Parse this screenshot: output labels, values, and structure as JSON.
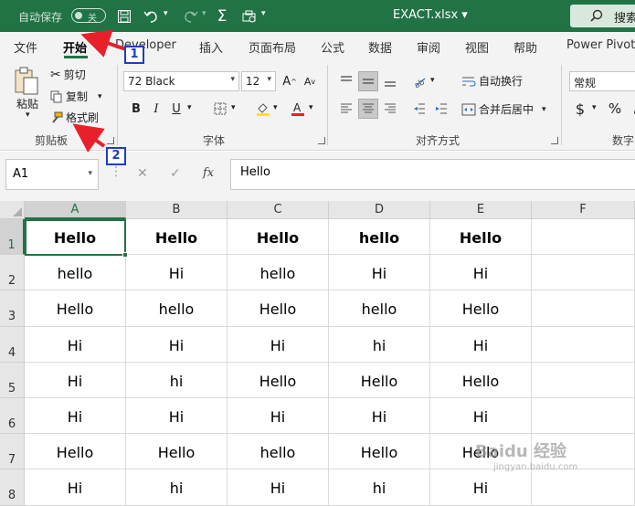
{
  "titlebar": {
    "autosave_label": "自动保存",
    "autosave_state": "关",
    "filename": "EXACT.xlsx",
    "search_label": "搜索"
  },
  "menu": {
    "tabs": [
      "文件",
      "开始",
      "Developer",
      "插入",
      "页面布局",
      "公式",
      "数据",
      "审阅",
      "视图",
      "帮助",
      "Power Pivot"
    ],
    "active": "开始"
  },
  "ribbon": {
    "clipboard": {
      "paste": "粘贴",
      "cut": "剪切",
      "copy": "复制",
      "format_painter": "格式刷",
      "group": "剪贴板"
    },
    "font": {
      "name": "72 Black",
      "size": "12",
      "bold": "B",
      "italic": "I",
      "underline": "U",
      "group": "字体"
    },
    "alignment": {
      "wrap": "自动换行",
      "merge": "合并后居中",
      "group": "对齐方式"
    },
    "number": {
      "format": "常规",
      "currency": "$",
      "percent": "%",
      "group": "数字"
    }
  },
  "formula_bar": {
    "name_box": "A1",
    "fx": "fx",
    "value": "Hello"
  },
  "sheet": {
    "columns": [
      "A",
      "B",
      "C",
      "D",
      "E",
      "F"
    ],
    "rows": [
      "1",
      "2",
      "3",
      "4",
      "5",
      "6",
      "7",
      "8"
    ],
    "cells": [
      [
        "Hello",
        "Hello",
        "Hello",
        "hello",
        "Hello",
        ""
      ],
      [
        "hello",
        "Hi",
        "hello",
        "Hi",
        "Hi",
        ""
      ],
      [
        "Hello",
        "hello",
        "Hello",
        "hello",
        "Hello",
        ""
      ],
      [
        "Hi",
        "Hi",
        "Hi",
        "hi",
        "Hi",
        ""
      ],
      [
        "Hi",
        "hi",
        "Hello",
        "Hello",
        "Hello",
        ""
      ],
      [
        "Hi",
        "Hi",
        "Hi",
        "Hi",
        "Hi",
        ""
      ],
      [
        "Hello",
        "Hello",
        "hello",
        "Hello",
        "Hello",
        ""
      ],
      [
        "Hi",
        "hi",
        "Hi",
        "hi",
        "Hi",
        ""
      ]
    ],
    "selected_cell": "A1"
  },
  "annotations": [
    "1",
    "2"
  ],
  "watermark": {
    "text": "Baidu 经验",
    "sub": "jingyan.baidu.com"
  },
  "colors": {
    "accent": "#217346",
    "annotation": "#1d3fbf",
    "arrow": "#e8202a"
  }
}
